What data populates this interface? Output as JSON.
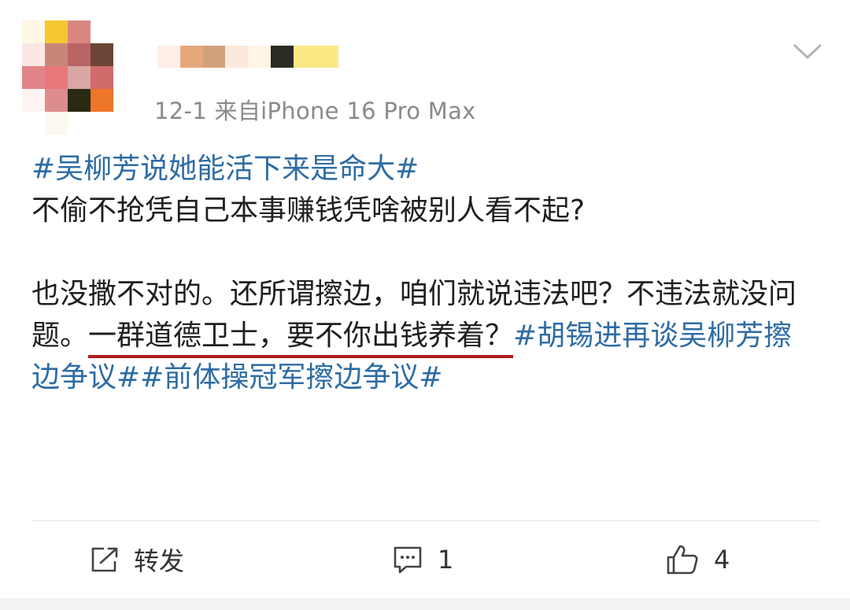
{
  "post": {
    "meta": "12-1  来自iPhone 16 Pro Max",
    "content": {
      "hashtag_topic": "#吴柳芳说她能活下来是命大#",
      "line1": "不偷不抢凭自己本事赚钱凭啥被别人看不起?",
      "para2_part1": "也没撒不对的。还所谓擦边，咱们就说违法吧？不违法就没问题。",
      "para2_underlined": "一群道德卫士，要不你出钱养着？",
      "hashtags_tail": "#胡锡进再谈吴柳芳擦边争议##前体操冠军擦边争议#"
    }
  },
  "actions": {
    "forward_label": "转发",
    "comment_count": "1",
    "like_count": "4"
  },
  "colors": {
    "hashtag": "#2e6ca4",
    "underline": "#b01b1b",
    "meta_text": "#8a8a8a"
  },
  "icons": [
    "chevron-down-icon",
    "forward-icon",
    "comment-icon",
    "like-icon"
  ]
}
